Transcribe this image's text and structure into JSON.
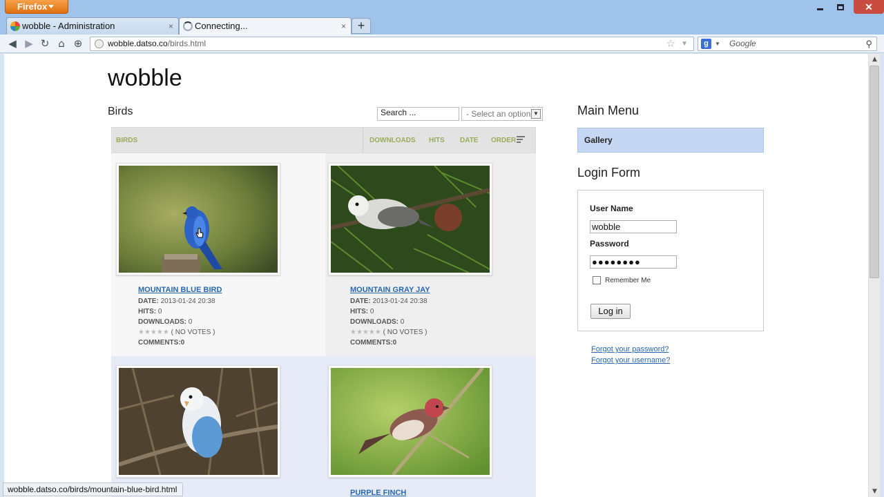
{
  "browser": {
    "app_button": "Firefox",
    "close_glyph": "✕",
    "tabs": [
      {
        "title": "wobble - Administration",
        "close": "×"
      },
      {
        "title": "Connecting...",
        "close": "×"
      }
    ],
    "new_tab": "+",
    "url": {
      "domain": "wobble.datso.co",
      "path": "/birds.html"
    },
    "search": {
      "placeholder": "Google"
    },
    "status_url": "wobble.datso.co/birds/mountain-blue-bird.html"
  },
  "site": {
    "title": "wobble",
    "section": "Birds",
    "search_value": "Search ...",
    "select_value": "- Select an option -"
  },
  "gallery": {
    "header": {
      "category": "BIRDS",
      "downloads": "DOWNLOADS",
      "hits": "HITS",
      "date": "DATE",
      "order": "ORDER"
    },
    "items": [
      {
        "title": "MOUNTAIN BLUE BIRD",
        "date_label": "DATE:",
        "date": "2013-01-24 20:38",
        "hits_label": "HITS:",
        "hits": "0",
        "downloads_label": "DOWNLOADS:",
        "downloads": "0",
        "stars": "★★★★★",
        "votes": "( NO VOTES )",
        "comments_label": "COMMENTS:",
        "comments": "0"
      },
      {
        "title": "MOUNTAIN GRAY JAY",
        "date_label": "DATE:",
        "date": "2013-01-24 20:38",
        "hits_label": "HITS:",
        "hits": "0",
        "downloads_label": "DOWNLOADS:",
        "downloads": "0",
        "stars": "★★★★★",
        "votes": "( NO VOTES )",
        "comments_label": "COMMENTS:",
        "comments": "0"
      },
      {
        "title": ""
      },
      {
        "title": "PURPLE FINCH"
      }
    ]
  },
  "sidebar": {
    "menu_title": "Main Menu",
    "menu_items": [
      "Gallery"
    ],
    "login": {
      "title": "Login Form",
      "username_label": "User Name",
      "username_value": "wobble",
      "password_label": "Password",
      "password_value": "●●●●●●●●",
      "remember": "Remember Me",
      "button": "Log in",
      "forgot_password": "Forgot your password?",
      "forgot_username": "Forgot your username?"
    }
  },
  "colors": {
    "accent_green": "#9aab59",
    "link_blue": "#2667b3",
    "menu_active": "#c5d7f3",
    "firefox_orange": "#e0700f"
  }
}
